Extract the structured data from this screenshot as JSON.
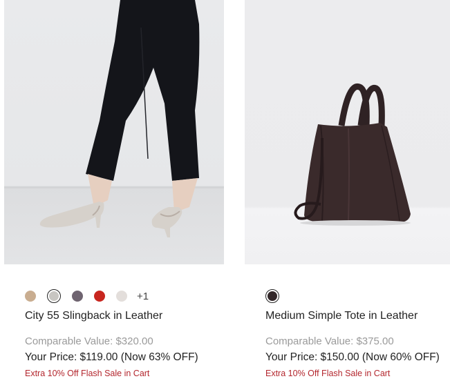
{
  "products": [
    {
      "name": "City 55 Slingback in Leather",
      "image_alt": "City 55 Slingback in Leather",
      "swatches": [
        {
          "color": "#c9ad90",
          "selected": false
        },
        {
          "color": "#c8c6c2",
          "selected": true
        },
        {
          "color": "#6f6470",
          "selected": false
        },
        {
          "color": "#c8261f",
          "selected": false
        },
        {
          "color": "#e3dedb",
          "selected": false
        }
      ],
      "more_colors": "+1",
      "comparable_value": "Comparable Value: $320.00",
      "price": "Your Price: $119.00 (Now 63% OFF)",
      "promo": "Extra 10% Off Flash Sale in Cart"
    },
    {
      "name": "Medium Simple Tote in Leather",
      "image_alt": "Medium Simple Tote in Leather",
      "swatches": [
        {
          "color": "#33282a",
          "selected": true
        }
      ],
      "more_colors": "",
      "comparable_value": "Comparable Value: $375.00",
      "price": "Your Price: $150.00 (Now 60% OFF)",
      "promo": "Extra 10% Off Flash Sale in Cart"
    }
  ]
}
